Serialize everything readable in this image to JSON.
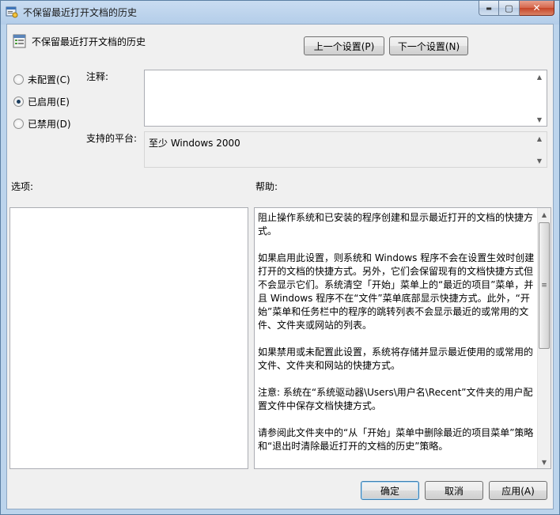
{
  "window": {
    "title": "不保留最近打开文档的历史",
    "controls": {
      "minimize": "▬",
      "maximize": "▢",
      "close": "✕"
    }
  },
  "policy": {
    "title": "不保留最近打开文档的历史",
    "prev_button": "上一个设置(P)",
    "next_button": "下一个设置(N)"
  },
  "state": {
    "options": [
      {
        "label": "未配置(C)",
        "checked": false
      },
      {
        "label": "已启用(E)",
        "checked": true
      },
      {
        "label": "已禁用(D)",
        "checked": false
      }
    ]
  },
  "comment": {
    "label": "注释:",
    "value": ""
  },
  "platform": {
    "label": "支持的平台:",
    "value": "至少 Windows 2000"
  },
  "options_panel": {
    "label": "选项:"
  },
  "help_panel": {
    "label": "帮助:",
    "paragraphs": [
      "阻止操作系统和已安装的程序创建和显示最近打开的文档的快捷方式。",
      "如果启用此设置，则系统和 Windows 程序不会在设置生效时创建打开的文档的快捷方式。另外，它们会保留现有的文档快捷方式但不会显示它们。系统清空「开始」菜单上的“最近的项目”菜单，并且 Windows 程序不在“文件”菜单底部显示快捷方式。此外，“开始”菜单和任务栏中的程序的跳转列表不会显示最近的或常用的文件、文件夹或网站的列表。",
      "如果禁用或未配置此设置，系统将存储并显示最近使用的或常用的文件、文件夹和网站的快捷方式。",
      "注意: 系统在“系统驱动器\\Users\\用户名\\Recent”文件夹的用户配置文件中保存文档快捷方式。",
      "请参阅此文件夹中的“从「开始」菜单中删除最近的项目菜单”策略和“退出时清除最近打开的文档的历史”策略。"
    ]
  },
  "footer": {
    "ok": "确定",
    "cancel": "取消",
    "apply": "应用(A)"
  }
}
